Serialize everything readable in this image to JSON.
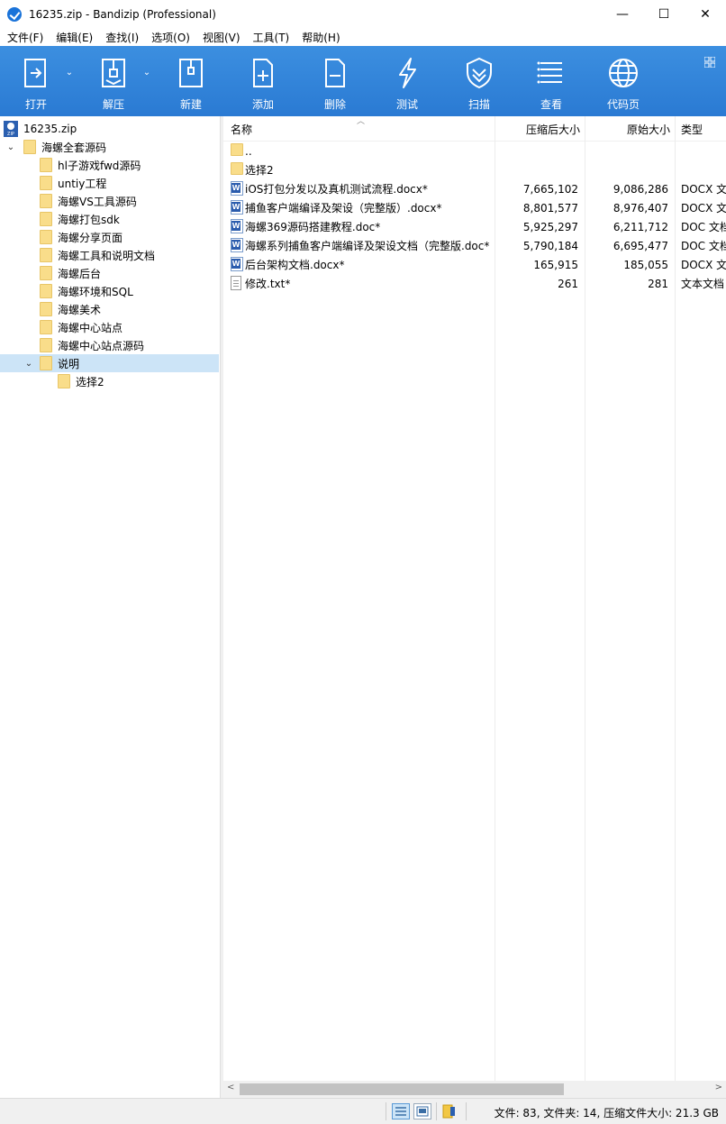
{
  "window": {
    "title": "16235.zip - Bandizip (Professional)",
    "minimize": "—",
    "maximize": "☐",
    "close": "✕"
  },
  "menu": [
    "文件(F)",
    "编辑(E)",
    "查找(I)",
    "选项(O)",
    "视图(V)",
    "工具(T)",
    "帮助(H)"
  ],
  "toolbar": {
    "open": "打开",
    "extract": "解压",
    "new": "新建",
    "add": "添加",
    "delete": "删除",
    "test": "测试",
    "scan": "扫描",
    "view": "查看",
    "codepage": "代码页",
    "dropdown": "⌄"
  },
  "tree": {
    "root": "16235.zip",
    "folder": "海螺全套源码",
    "children": [
      "hl子游戏fwd源码",
      "untiy工程",
      "海螺VS工具源码",
      "海螺打包sdk",
      "海螺分享页面",
      "海螺工具和说明文档",
      "海螺后台",
      "海螺环境和SQL",
      "海螺美术",
      "海螺中心站点",
      "海螺中心站点源码",
      "说明"
    ],
    "selected_child": "选择2",
    "expanded_arrow": "⌄"
  },
  "columns": {
    "name": "名称",
    "compressed": "压缩后大小",
    "original": "原始大小",
    "type": "类型"
  },
  "files": [
    {
      "icon": "folder-icon",
      "name": "..",
      "compressed": "",
      "original": "",
      "type": ""
    },
    {
      "icon": "folder-icon",
      "name": "选择2",
      "compressed": "",
      "original": "",
      "type": ""
    },
    {
      "icon": "word-icon",
      "name": "iOS打包分发以及真机测试流程.docx*",
      "compressed": "7,665,102",
      "original": "9,086,286",
      "type": "DOCX 文"
    },
    {
      "icon": "word-icon",
      "name": "捕鱼客户端编译及架设（完整版）.docx*",
      "compressed": "8,801,577",
      "original": "8,976,407",
      "type": "DOCX 文"
    },
    {
      "icon": "word-icon",
      "name": "海螺369源码搭建教程.doc*",
      "compressed": "5,925,297",
      "original": "6,211,712",
      "type": "DOC 文档"
    },
    {
      "icon": "word-icon",
      "name": "海螺系列捕鱼客户端编译及架设文档（完整版.doc*",
      "compressed": "5,790,184",
      "original": "6,695,477",
      "type": "DOC 文档"
    },
    {
      "icon": "word-icon",
      "name": "后台架构文档.docx*",
      "compressed": "165,915",
      "original": "185,055",
      "type": "DOCX 文"
    },
    {
      "icon": "txt-icon",
      "name": "修改.txt*",
      "compressed": "261",
      "original": "281",
      "type": "文本文档"
    }
  ],
  "status": {
    "text": "文件: 83, 文件夹: 14, 压缩文件大小: 21.3 GB"
  }
}
